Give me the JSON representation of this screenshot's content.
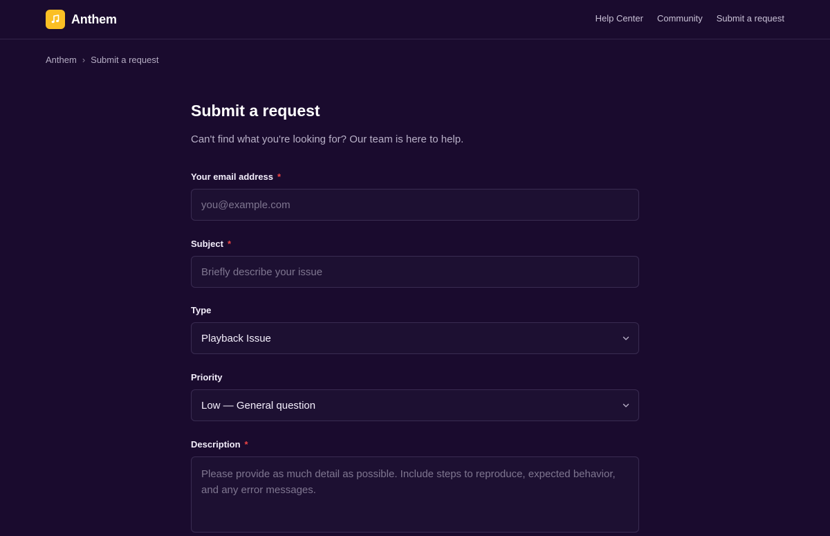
{
  "brand": {
    "name": "Anthem",
    "accent_color": "#fbbf24",
    "logo_icon": "music-note-icon"
  },
  "nav": {
    "help_center": "Help Center",
    "community": "Community",
    "submit_request": "Submit a request"
  },
  "breadcrumb": {
    "home": "Anthem",
    "separator": "›",
    "current": "Submit a request"
  },
  "page": {
    "title": "Submit a request",
    "subtitle": "Can't find what you're looking for? Our team is here to help."
  },
  "form": {
    "required_marker": "*",
    "email": {
      "label": "Your email address",
      "placeholder": "you@example.com",
      "value": ""
    },
    "subject": {
      "label": "Subject",
      "placeholder": "Briefly describe your issue",
      "value": ""
    },
    "type": {
      "label": "Type",
      "selected": "Playback Issue"
    },
    "priority": {
      "label": "Priority",
      "selected": "Low — General question"
    },
    "description": {
      "label": "Description",
      "placeholder": "Please provide as much detail as possible. Include steps to reproduce, expected behavior, and any error messages.",
      "value": ""
    }
  },
  "colors": {
    "background": "#1a0b2e",
    "required": "#ef4444"
  }
}
